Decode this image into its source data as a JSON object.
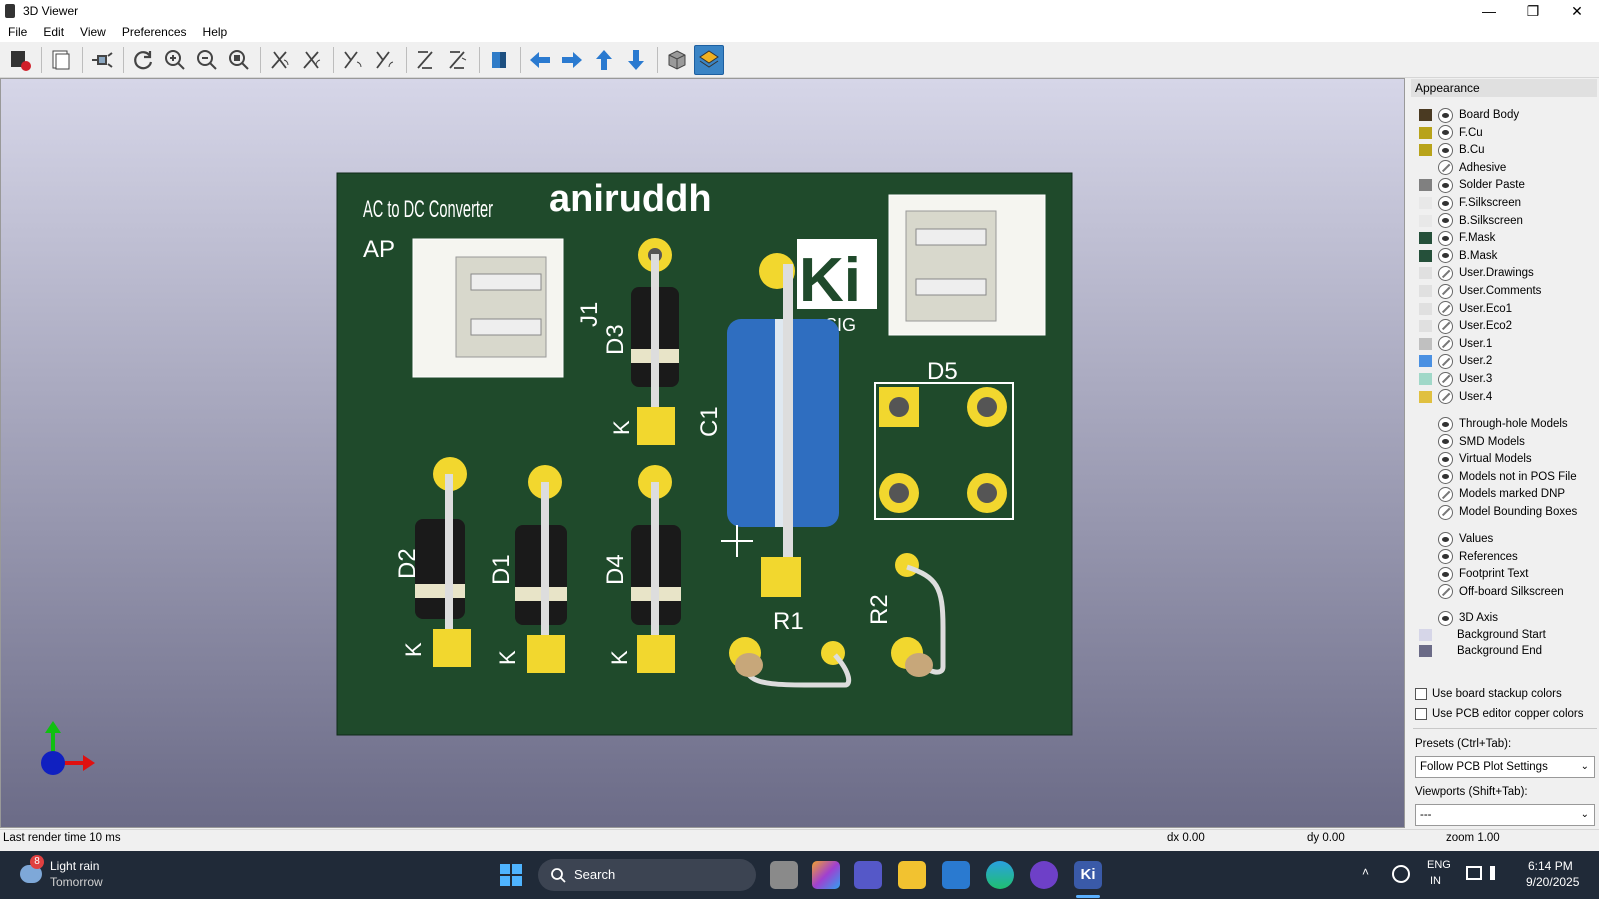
{
  "window": {
    "title": "3D Viewer",
    "minimize_glyph": "—",
    "maximize_glyph": "❐",
    "close_glyph": "✕"
  },
  "menu": [
    "File",
    "Edit",
    "View",
    "Preferences",
    "Help"
  ],
  "toolbar": {
    "icons": [
      "render-photo-icon",
      "copy-image-icon",
      "raytrace-icon",
      "reload-icon",
      "zoom-in-icon",
      "zoom-out-icon",
      "zoom-fit-icon",
      "rotate-x-cw-icon",
      "rotate-x-ccw-icon",
      "rotate-y-cw-icon",
      "rotate-y-ccw-icon",
      "rotate-z-cw-icon",
      "rotate-z-ccw-icon",
      "flip-board-icon",
      "move-left-icon",
      "move-right-icon",
      "move-up-icon",
      "move-down-icon",
      "ortho-view-icon",
      "layers-icon"
    ]
  },
  "pcb": {
    "silk": {
      "title": "AC to DC Converter",
      "author": "aniruddh",
      "initials": "AP",
      "logo": "Ki",
      "logo_sub": "SIG",
      "refs": [
        "J1",
        "D3",
        "K",
        "C1",
        "D5",
        "D2",
        "D1",
        "D4",
        "K",
        "K",
        "K",
        "R1",
        "R2"
      ]
    },
    "colors": {
      "board": "#1f4a2b",
      "pad": "#f2d72e",
      "silk": "#ffffff",
      "cap": "#2f6ec0"
    }
  },
  "appearance": {
    "title": "Appearance",
    "layers": [
      {
        "name": "Board Body",
        "color": "#4a3a22",
        "visible": true
      },
      {
        "name": "F.Cu",
        "color": "#b8a31a",
        "visible": true
      },
      {
        "name": "B.Cu",
        "color": "#b8a31a",
        "visible": true
      },
      {
        "name": "Adhesive",
        "color": "",
        "visible": false
      },
      {
        "name": "Solder Paste",
        "color": "#808080",
        "visible": true
      },
      {
        "name": "F.Silkscreen",
        "color": "#e8e8e8",
        "visible": true
      },
      {
        "name": "B.Silkscreen",
        "color": "#e8e8e8",
        "visible": true
      },
      {
        "name": "F.Mask",
        "color": "#25503a",
        "visible": true
      },
      {
        "name": "B.Mask",
        "color": "#25503a",
        "visible": true
      },
      {
        "name": "User.Drawings",
        "color": "#e0e0e0",
        "visible": false
      },
      {
        "name": "User.Comments",
        "color": "#e0e0e0",
        "visible": false
      },
      {
        "name": "User.Eco1",
        "color": "#e0e0e0",
        "visible": false
      },
      {
        "name": "User.Eco2",
        "color": "#e0e0e0",
        "visible": false
      },
      {
        "name": "User.1",
        "color": "#c0c0c0",
        "visible": false
      },
      {
        "name": "User.2",
        "color": "#4a90e2",
        "visible": false
      },
      {
        "name": "User.3",
        "color": "#a0d8c8",
        "visible": false
      },
      {
        "name": "User.4",
        "color": "#e0c040",
        "visible": false
      }
    ],
    "models": [
      {
        "name": "Through-hole Models",
        "visible": true
      },
      {
        "name": "SMD Models",
        "visible": true
      },
      {
        "name": "Virtual Models",
        "visible": true
      },
      {
        "name": "Models not in POS File",
        "visible": true
      },
      {
        "name": "Models marked DNP",
        "visible": false
      },
      {
        "name": "Model Bounding Boxes",
        "visible": false
      }
    ],
    "texts": [
      {
        "name": "Values",
        "visible": true
      },
      {
        "name": "References",
        "visible": true
      },
      {
        "name": "Footprint Text",
        "visible": true
      },
      {
        "name": "Off-board Silkscreen",
        "visible": false
      }
    ],
    "axis": {
      "name": "3D Axis",
      "visible": true
    },
    "bg_start": {
      "name": "Background Start",
      "color": "#d6d6e8"
    },
    "bg_end": {
      "name": "Background End",
      "color": "#6b6b87"
    },
    "use_stackup": "Use board stackup colors",
    "use_pcb_copper": "Use PCB editor copper colors",
    "presets_label": "Presets (Ctrl+Tab):",
    "presets_value": "Follow PCB Plot Settings",
    "viewports_label": "Viewports (Shift+Tab):",
    "viewports_value": "---"
  },
  "status": {
    "render_time": "Last render time 10 ms",
    "dx": "dx 0.00",
    "dy": "dy 0.00",
    "zoom": "zoom 1.00"
  },
  "taskbar": {
    "weather_badge": "8",
    "weather_line1": "Light rain",
    "weather_line2": "Tomorrow",
    "search": "Search",
    "lang1": "ENG",
    "lang2": "IN",
    "time": "6:14 PM",
    "date": "9/20/2025"
  }
}
